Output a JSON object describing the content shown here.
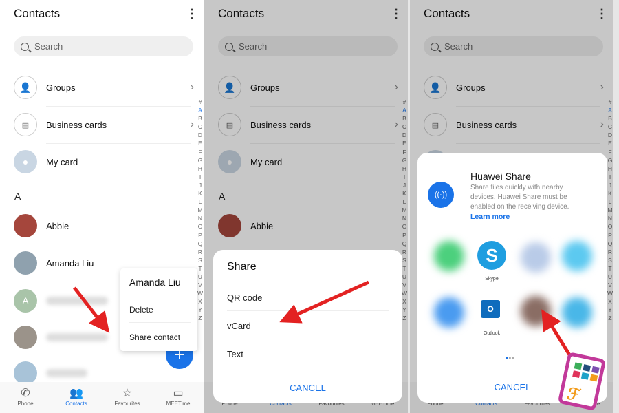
{
  "header": {
    "title": "Contacts",
    "more_icon": "kebab-vertical-icon"
  },
  "search": {
    "placeholder": "Search"
  },
  "rows": {
    "groups": "Groups",
    "business_cards": "Business cards",
    "my_card": "My card"
  },
  "section": "A",
  "contacts": [
    "Abbie",
    "Amanda Liu"
  ],
  "blurred_avatar_initial": "A",
  "index": [
    "#",
    "A",
    "B",
    "C",
    "D",
    "E",
    "F",
    "G",
    "H",
    "I",
    "J",
    "K",
    "L",
    "M",
    "N",
    "O",
    "P",
    "Q",
    "R",
    "S",
    "T",
    "U",
    "V",
    "W",
    "X",
    "Y",
    "Z"
  ],
  "index_active": "A",
  "nav": [
    "Phone",
    "Contacts",
    "Favourites",
    "MEETime"
  ],
  "nav_active": "Contacts",
  "context_menu": {
    "title": "Amanda Liu",
    "items": [
      "Delete",
      "Share contact"
    ]
  },
  "share_sheet": {
    "title": "Share",
    "items": [
      "QR code",
      "vCard",
      "Text"
    ],
    "cancel": "CANCEL"
  },
  "huawei_share": {
    "title": "Huawei Share",
    "description": "Share files quickly with nearby devices. Huawei Share must be enabled on the receiving device.",
    "link": "Learn more",
    "apps": [
      "Skype",
      "Outlook"
    ],
    "cancel": "CANCEL",
    "page": 1,
    "pages": 3
  },
  "colors": {
    "accent": "#1a73e8",
    "arrow": "#e32222"
  }
}
